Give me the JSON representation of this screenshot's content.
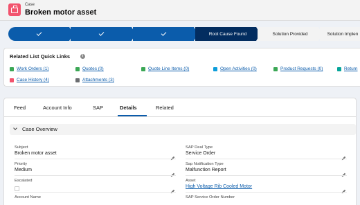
{
  "header": {
    "object_type": "Case",
    "record_name": "Broken motor asset"
  },
  "path": {
    "stages": [
      {
        "label": "",
        "state": "done"
      },
      {
        "label": "",
        "state": "done"
      },
      {
        "label": "",
        "state": "done"
      },
      {
        "label": "Root Cause Found",
        "state": "current"
      },
      {
        "label": "Solution Provided",
        "state": "todo"
      },
      {
        "label": "Solution Implen",
        "state": "todo"
      }
    ]
  },
  "quick_links": {
    "title": "Related List Quick Links",
    "items": [
      {
        "label": "Work Orders (1)",
        "icon": "work-order-icon",
        "color": "#3ba755"
      },
      {
        "label": "Quotes (0)",
        "icon": "quote-icon",
        "color": "#3ba755"
      },
      {
        "label": "Quote Line Items (0)",
        "icon": "quote-line-icon",
        "color": "#3ba755"
      },
      {
        "label": "Open Activities (0)",
        "icon": "activity-icon",
        "color": "#0d9dda"
      },
      {
        "label": "Product Requests (0)",
        "icon": "product-request-icon",
        "color": "#3ba755"
      },
      {
        "label": "Return",
        "icon": "return-icon",
        "color": "#06a59a"
      },
      {
        "label": "Case History (4)",
        "icon": "case-history-icon",
        "color": "#f2536d"
      },
      {
        "label": "Attachments (3)",
        "icon": "attachment-icon",
        "color": "#6b6d70"
      }
    ]
  },
  "tabs": [
    "Feed",
    "Account Info",
    "SAP",
    "Details",
    "Related"
  ],
  "active_tab": "Details",
  "section": {
    "title": "Case Overview"
  },
  "fields_left": [
    {
      "label": "Subject",
      "value": "Broken motor asset"
    },
    {
      "label": "Priority",
      "value": "Medium"
    },
    {
      "label": "Escalated",
      "value": ""
    },
    {
      "label": "Account Name",
      "value": ""
    }
  ],
  "fields_right": [
    {
      "label": "SAP Deal Type",
      "value": "Service Order"
    },
    {
      "label": "Sap Notification Type",
      "value": "Malfunction Report"
    },
    {
      "label": "Asset",
      "value": "High Voltage Rib Cooled Motor"
    },
    {
      "label": "SAP Service Order Number",
      "value": ""
    }
  ],
  "colors": {
    "brand": "#0b5cab",
    "path_current": "#032d60",
    "case_icon": "#f2536d"
  }
}
